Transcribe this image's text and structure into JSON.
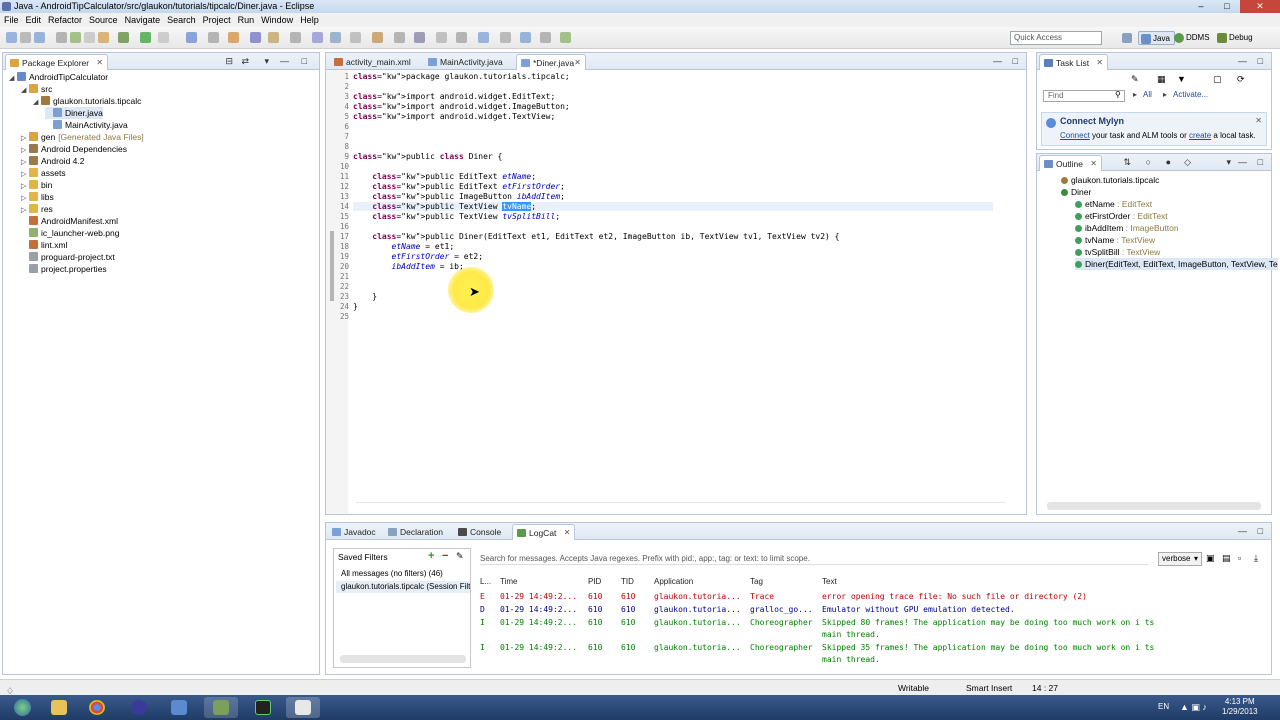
{
  "window": {
    "title": "Java - AndroidTipCalculator/src/glaukon/tutorials/tipcalc/Diner.java - Eclipse"
  },
  "menu": [
    "File",
    "Edit",
    "Refactor",
    "Source",
    "Navigate",
    "Search",
    "Project",
    "Run",
    "Window",
    "Help"
  ],
  "toolbar": {
    "quick_access": "Quick Access",
    "perspectives": [
      "Java",
      "DDMS",
      "Debug"
    ]
  },
  "package_explorer": {
    "title": "Package Explorer",
    "tree": [
      {
        "label": "AndroidTipCalculator",
        "indent": 0,
        "icon": "project-icon",
        "color": "#6b8bc6"
      },
      {
        "label": "src",
        "indent": 1,
        "icon": "source-folder-icon",
        "color": "#d9a441"
      },
      {
        "label": "glaukon.tutorials.tipcalc",
        "indent": 2,
        "icon": "package-icon",
        "color": "#a07a3a"
      },
      {
        "label": "Diner.java",
        "indent": 3,
        "icon": "java-file-icon",
        "color": "#7b9fd6"
      },
      {
        "label": "MainActivity.java",
        "indent": 3,
        "icon": "java-file-icon",
        "color": "#7b9fd6"
      },
      {
        "label": "gen",
        "extra": "[Generated Java Files]",
        "indent": 1,
        "icon": "folder-icon",
        "color": "#d9a441"
      },
      {
        "label": "Android Dependencies",
        "indent": 1,
        "icon": "library-icon",
        "color": "#9a7a4a"
      },
      {
        "label": "Android 4.2",
        "indent": 1,
        "icon": "library-icon",
        "color": "#9a7a4a"
      },
      {
        "label": "assets",
        "indent": 1,
        "icon": "folder-icon",
        "color": "#e2b54a"
      },
      {
        "label": "bin",
        "indent": 1,
        "icon": "folder-icon",
        "color": "#e2b54a"
      },
      {
        "label": "libs",
        "indent": 1,
        "icon": "folder-icon",
        "color": "#e2b54a"
      },
      {
        "label": "res",
        "indent": 1,
        "icon": "folder-icon",
        "color": "#e2b54a"
      },
      {
        "label": "AndroidManifest.xml",
        "indent": 1,
        "icon": "xml-file-icon",
        "color": "#c26f3d"
      },
      {
        "label": "ic_launcher-web.png",
        "indent": 1,
        "icon": "image-file-icon",
        "color": "#8fb36b"
      },
      {
        "label": "lint.xml",
        "indent": 1,
        "icon": "xml-file-icon",
        "color": "#c26f3d"
      },
      {
        "label": "proguard-project.txt",
        "indent": 1,
        "icon": "text-file-icon",
        "color": "#9aa0a8"
      },
      {
        "label": "project.properties",
        "indent": 1,
        "icon": "text-file-icon",
        "color": "#9aa0a8"
      }
    ]
  },
  "editor": {
    "tabs": [
      "activity_main.xml",
      "MainActivity.java",
      "*Diner.java"
    ],
    "lines": [
      {
        "n": "1",
        "t": "package glaukon.tutorials.tipcalc;"
      },
      {
        "n": "2",
        "t": ""
      },
      {
        "n": "3",
        "t": "import android.widget.EditText;"
      },
      {
        "n": "4",
        "t": "import android.widget.ImageButton;"
      },
      {
        "n": "5",
        "t": "import android.widget.TextView;"
      },
      {
        "n": "6",
        "t": ""
      },
      {
        "n": "7",
        "t": ""
      },
      {
        "n": "8",
        "t": ""
      },
      {
        "n": "9",
        "t": "public class Diner {"
      },
      {
        "n": "10",
        "t": ""
      },
      {
        "n": "11",
        "t": "    public EditText etName;"
      },
      {
        "n": "12",
        "t": "    public EditText etFirstOrder;"
      },
      {
        "n": "13",
        "t": "    public ImageButton ibAddItem;"
      },
      {
        "n": "14",
        "t": "    public TextView tvName;"
      },
      {
        "n": "15",
        "t": "    public TextView tvSplitBill;"
      },
      {
        "n": "16",
        "t": ""
      },
      {
        "n": "17",
        "t": "    public Diner(EditText et1, EditText et2, ImageButton ib, TextView tv1, TextView tv2) {"
      },
      {
        "n": "18",
        "t": "        etName = et1;"
      },
      {
        "n": "19",
        "t": "        etFirstOrder = et2;"
      },
      {
        "n": "20",
        "t": "        ibAddItem = ib;"
      },
      {
        "n": "21",
        "t": ""
      },
      {
        "n": "22",
        "t": ""
      },
      {
        "n": "23",
        "t": "    }"
      },
      {
        "n": "24",
        "t": "}"
      },
      {
        "n": "25",
        "t": ""
      }
    ]
  },
  "task_list": {
    "title": "Task List",
    "find_placeholder": "Find",
    "all_label": "All",
    "activate_label": "Activate..."
  },
  "mylyn": {
    "title": "Connect Mylyn",
    "text_pre": "Connect",
    "text_mid": " your task and ALM tools or ",
    "text_link": "create",
    "text_post": " a local task."
  },
  "outline": {
    "title": "Outline",
    "items": [
      {
        "label": "glaukon.tutorials.tipcalc",
        "type": "",
        "indent": 1
      },
      {
        "label": "Diner",
        "type": "",
        "indent": 1
      },
      {
        "label": "etName",
        "type": " : EditText",
        "indent": 2
      },
      {
        "label": "etFirstOrder",
        "type": " : EditText",
        "indent": 2
      },
      {
        "label": "ibAddItem",
        "type": " : ImageButton",
        "indent": 2
      },
      {
        "label": "tvName",
        "type": " : TextView",
        "indent": 2
      },
      {
        "label": "tvSplitBill",
        "type": " : TextView",
        "indent": 2
      },
      {
        "label": "Diner(EditText, EditText, ImageButton, TextView, Te",
        "type": "",
        "indent": 2
      }
    ]
  },
  "bottom": {
    "tabs": [
      "Javadoc",
      "Declaration",
      "Console",
      "LogCat"
    ],
    "saved_filters": "Saved Filters",
    "filters": [
      "All messages (no filters) (46)",
      "glaukon.tutorials.tipcalc (Session Filt"
    ],
    "search_placeholder": "Search for messages. Accepts Java regexes. Prefix with pid:, app:, tag: or text: to limit scope.",
    "level": "verbose",
    "columns": [
      "L...",
      "Time",
      "PID",
      "TID",
      "Application",
      "Tag",
      "Text"
    ],
    "rows": [
      {
        "l": "E",
        "time": "01-29 14:49:2...",
        "pid": "610",
        "tid": "610",
        "app": "glaukon.tutoria...",
        "tag": "Trace",
        "text": "error opening trace file: No such file or directory (2)",
        "color": "#c00000"
      },
      {
        "l": "D",
        "time": "01-29 14:49:2...",
        "pid": "610",
        "tid": "610",
        "app": "glaukon.tutoria...",
        "tag": "gralloc_go...",
        "text": "Emulator without GPU emulation detected.",
        "color": "#00008b"
      },
      {
        "l": "I",
        "time": "01-29 14:49:2...",
        "pid": "610",
        "tid": "610",
        "app": "glaukon.tutoria...",
        "tag": "Choreographer",
        "text": "Skipped 80 frames!  The application may be doing too much work on i ts main thread.",
        "color": "#008000"
      },
      {
        "l": "I",
        "time": "01-29 14:49:2...",
        "pid": "610",
        "tid": "610",
        "app": "glaukon.tutoria...",
        "tag": "Choreographer",
        "text": "Skipped 35 frames!  The application may be doing too much work on i ts main thread.",
        "color": "#008000"
      }
    ]
  },
  "status": {
    "writable": "Writable",
    "insert": "Smart Insert",
    "position": "14 : 27"
  },
  "taskbar": {
    "lang": "EN",
    "time": "4:13 PM",
    "date": "1/29/2013"
  }
}
